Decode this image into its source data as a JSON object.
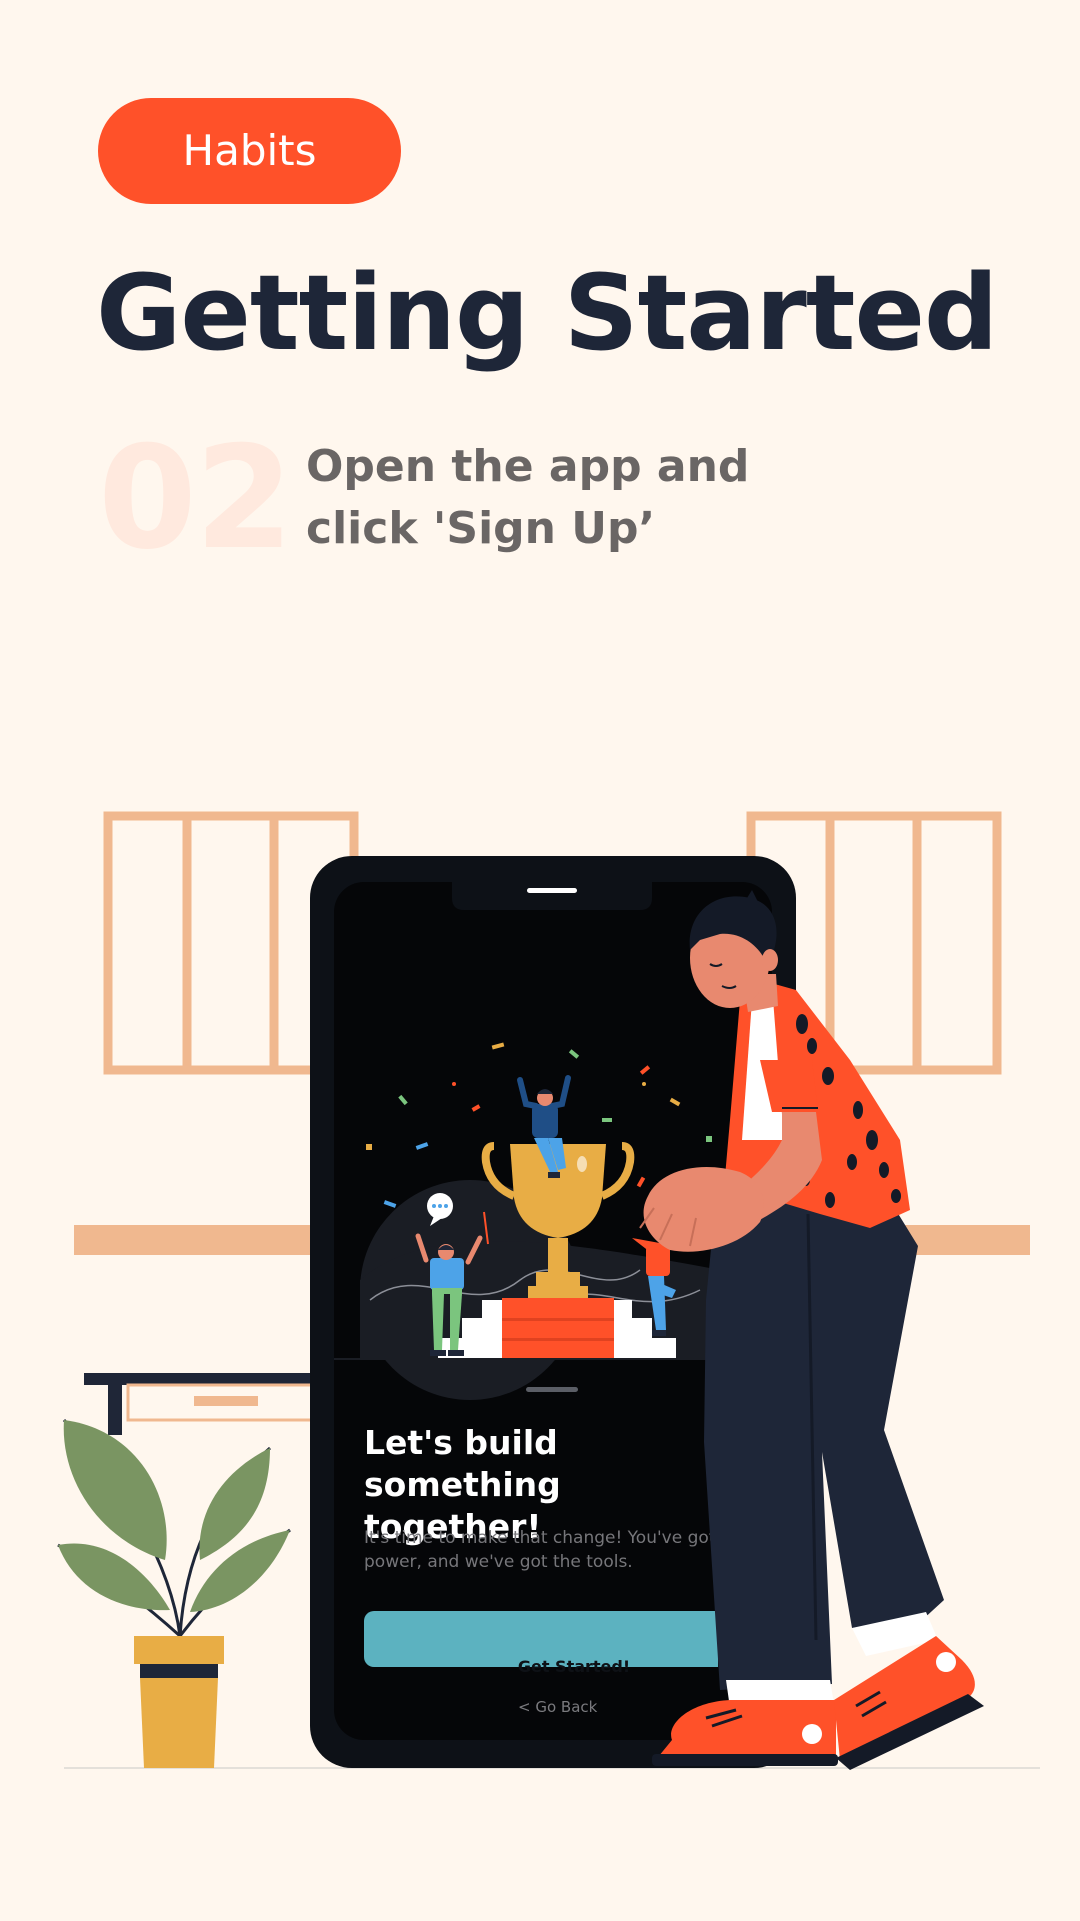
{
  "brand": {
    "logo_text": "Habits"
  },
  "header": {
    "title": "Getting Started"
  },
  "step": {
    "number": "02",
    "instruction": "Open the app and click 'Sign Up’"
  },
  "phone": {
    "sheet_title": "Let's build something together!",
    "sheet_body": "It's time to make that change! You've got the power, and we've got the tools.",
    "primary_button": "Get Started!",
    "back_link": "< Go Back"
  },
  "colors": {
    "background": "#FFF7EE",
    "brand_orange": "#FF5129",
    "title_navy": "#1E2638",
    "step_number_tint": "#FFE9DE",
    "button_teal": "#5CB2C0",
    "phone_black": "#0D1117"
  },
  "icons": {
    "illustration": "person-with-phone-illustration",
    "trophy": "trophy-icon",
    "plant": "plant-illustration",
    "speech": "speech-bubble-icon"
  }
}
